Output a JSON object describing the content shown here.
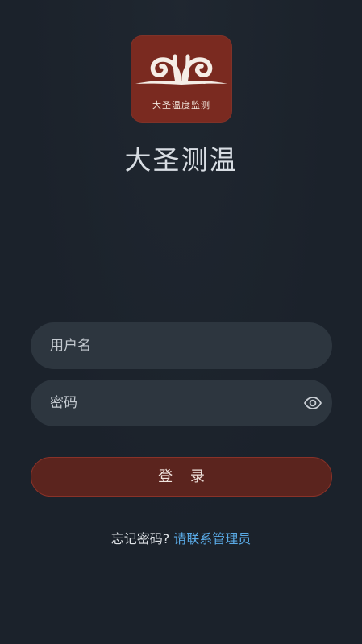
{
  "logo": {
    "caption": "大圣温度监测",
    "icon": "swirl-emblem-icon",
    "background_color": "#7a2a20"
  },
  "app": {
    "title": "大圣测温"
  },
  "form": {
    "username_placeholder": "用户名",
    "username_value": "",
    "password_placeholder": "密码",
    "password_value": "",
    "password_toggle_icon": "eye-icon",
    "login_label": "登 录"
  },
  "footer": {
    "forgot_text": "忘记密码?",
    "contact_link": "请联系管理员"
  },
  "colors": {
    "background": "#1b222b",
    "field_background": "#2d363f",
    "button_background": "#5b241e",
    "link": "#5aaae6"
  }
}
